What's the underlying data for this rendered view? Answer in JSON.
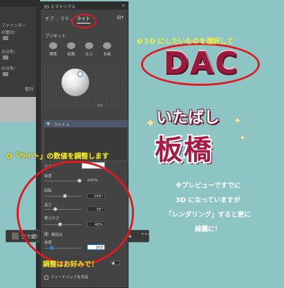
{
  "background_panel": {
    "title": "ファインダー",
    "row_labels": [
      "の整列：",
      "の分布：",
      "の分布：",
      "整列"
    ]
  },
  "layer_bar": {
    "name": "生で鍵!"
  },
  "panel": {
    "title": "3D とマテリアル",
    "tabs": [
      "オブ...",
      "マテ...",
      "ライト"
    ],
    "active_tab": "ライト",
    "presets_label": "プリセット",
    "presets": [
      "標準",
      "拡散",
      "左上",
      "右画"
    ],
    "preview_badge": "⊕3",
    "light_item": "ライト 1",
    "color_label": "カラー",
    "intensity": {
      "label": "強度",
      "value": "200%",
      "fraction": 0.95
    },
    "rotation": {
      "label": "回転",
      "value": "145°",
      "fraction": 0.55
    },
    "height": {
      "label": "高さ",
      "value": "35°",
      "fraction": 0.3
    },
    "softness": {
      "label": "柔らかさ",
      "value": "40%",
      "fraction": 0.42
    },
    "ambient_label": "環境光",
    "ambient_checked": true,
    "ambient_intensity": {
      "label": "強度",
      "value": "103",
      "fraction": 0.2
    },
    "feedback": "フィードバックを共有"
  },
  "annotations": {
    "step3": "❸３D にしたいものを選択して",
    "step4": "❹「ライト」の数値を調整します",
    "preference": "調整はお好みで！",
    "note_lines": [
      "※プレビューですでに",
      "3D になっていますが",
      "「レンダリング」すると更に",
      "綺麗に！"
    ]
  },
  "artwork": {
    "dac": "DAC",
    "logo_kana": "いたばし",
    "logo_kanji": "板橋"
  },
  "colors": {
    "annotation_yellow": "#f5ee3a",
    "oval_red": "#e01a22",
    "canvas_teal": "#8dc4c4",
    "dac_color": "#9a1a3b"
  }
}
